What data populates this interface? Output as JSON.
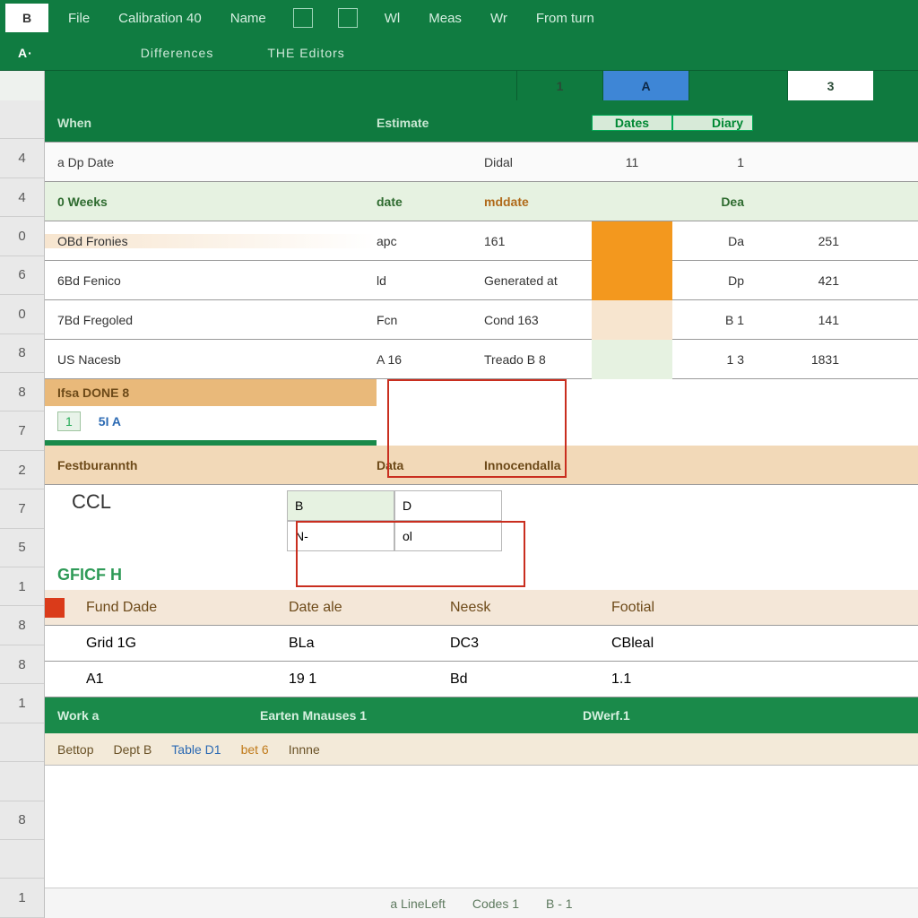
{
  "ribbon": {
    "namebox": "B",
    "tabs": [
      "File",
      "Calibration 40",
      "Name",
      "",
      "",
      "Wl",
      "Meas",
      "Wr",
      "From turn"
    ],
    "fx": "A·",
    "groups": [
      "Differences",
      "THE Editors"
    ]
  },
  "colheaders": {
    "one": "1",
    "A": "A",
    "three": "3"
  },
  "rowheaders": [
    "",
    "4",
    "4",
    "0",
    "6",
    "0",
    "8",
    "8",
    "7",
    "2",
    "7",
    "5",
    "1",
    "8",
    "8",
    "1",
    "",
    "",
    "8",
    "",
    "1"
  ],
  "section1": {
    "header": {
      "name": "When",
      "col_b": "Estimate",
      "col_d": "Dates",
      "col_e": "Diary"
    },
    "row_date": {
      "label": "a Dp Date",
      "col_c": "Didal",
      "col_d": "11",
      "col_e": "1"
    },
    "row_weeks": {
      "label": "0 Weeks",
      "col_b": "date",
      "col_c": "mddate",
      "col_e": "Dea"
    },
    "items": [
      {
        "a": "OBd Fronies",
        "b": "apc",
        "c": "161",
        "e": "Da",
        "f": "251"
      },
      {
        "a": "6Bd Fenico",
        "b": "ld",
        "c": "Generated at",
        "e": "Dp",
        "f": "421"
      },
      {
        "a": "7Bd Fregoled",
        "b": "Fcn",
        "c": "Cond 163",
        "e": "B 1",
        "f": "141"
      },
      {
        "a": "US Nacesb",
        "b": "A 16",
        "c": "Treado B 8",
        "e": "1 3",
        "f": "1831",
        "pale": true
      }
    ]
  },
  "calendar": {
    "title": "Ifsa DONE 8",
    "cellA": "1",
    "cellB": "5I A"
  },
  "section2": {
    "header": {
      "a": "Festburannth",
      "b": "Data",
      "c": "Innocendalla"
    },
    "ccl": "CCL",
    "mini": [
      {
        "c1": "B",
        "c2": "D"
      },
      {
        "c1": "N-",
        "c2": "ol"
      }
    ]
  },
  "section3": {
    "title": "GFICF H",
    "header": {
      "a": "Fund Dade",
      "b": "Date ale",
      "c": "Neesk",
      "d": "Footial"
    },
    "rows": [
      {
        "a": "Grid 1G",
        "b": "BLa",
        "c": "DC3",
        "d": "CBleal"
      },
      {
        "a": "A1",
        "b": "19 1",
        "c": "Bd",
        "d": "1.1"
      }
    ]
  },
  "section4": {
    "header": {
      "a": "Work a",
      "b": "Earten Mnauses 1",
      "c": "DWerf.1"
    },
    "tags": [
      "Bettop",
      "Dept B",
      "Table D1",
      "bet 6",
      "Innne"
    ]
  },
  "status": {
    "a": "a LineLeft",
    "b": "Codes 1",
    "c": "B - 1"
  }
}
